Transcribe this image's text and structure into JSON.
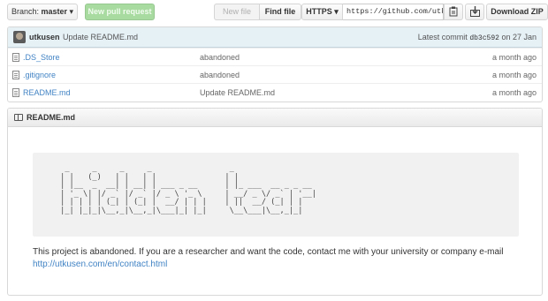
{
  "toolbar": {
    "branch_prefix": "Branch:",
    "branch_name": "master",
    "branch_caret": "▾",
    "new_pull_request": "New pull request",
    "new_file": "New file",
    "find_file": "Find file",
    "protocol": "HTTPS ▾",
    "clone_url": "https://github.com/utkusen/hidden-tear.git",
    "download_zip": "Download ZIP"
  },
  "commit": {
    "author": "utkusen",
    "message": "Update README.md",
    "latest_label": "Latest commit",
    "sha": "db3c592",
    "date": "on 27 Jan"
  },
  "files": [
    {
      "name": ".DS_Store",
      "message": "abandoned",
      "age": "a month ago"
    },
    {
      "name": ".gitignore",
      "message": "abandoned",
      "age": "a month ago"
    },
    {
      "name": "README.md",
      "message": "Update README.md",
      "age": "a month ago"
    }
  ],
  "readme": {
    "title": "README.md",
    "ascii_art": "  _     _     _     _                 _                   \n | |   (_)   | |   | |               | |                  \n | |__  _  __| | __| | ___ _ __      | |_ ___  __ _ _ __  \n | '_ \\| |/ _` |/ _` |/ _ \\ '_ \\     | __/ _ \\/ _` | '__| \n | | | | | (_| | (_| |  __/ | | |    | ||  __/ (_| | |    \n |_| |_|_|\\__,_|\\__,_|\\___|_| |_|     \\__\\___|\\__,_|_|    ",
    "notice": "This project is abandoned. If you are a researcher and want the code, contact me with your university or company e-mail",
    "link": "http://utkusen.com/en/contact.html"
  }
}
